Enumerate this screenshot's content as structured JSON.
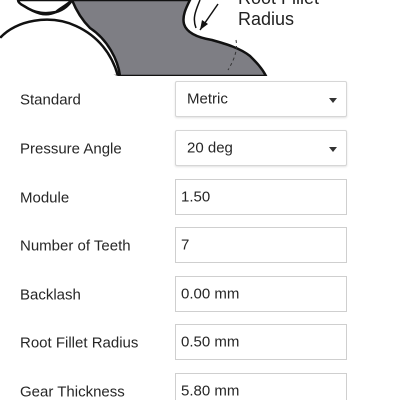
{
  "preview": {
    "annotation_line1": "Root Fillet",
    "annotation_line2": "Radius"
  },
  "form": {
    "standard": {
      "label": "Standard",
      "value": "Metric"
    },
    "pressure_angle": {
      "label": "Pressure Angle",
      "value": "20 deg"
    },
    "module": {
      "label": "Module",
      "value": "1.50"
    },
    "number_of_teeth": {
      "label": "Number of Teeth",
      "value": "7"
    },
    "backlash": {
      "label": "Backlash",
      "value": "0.00 mm"
    },
    "root_fillet_radius": {
      "label": "Root Fillet Radius",
      "value": "0.50 mm"
    },
    "gear_thickness": {
      "label": "Gear Thickness",
      "value": "5.80 mm"
    }
  }
}
